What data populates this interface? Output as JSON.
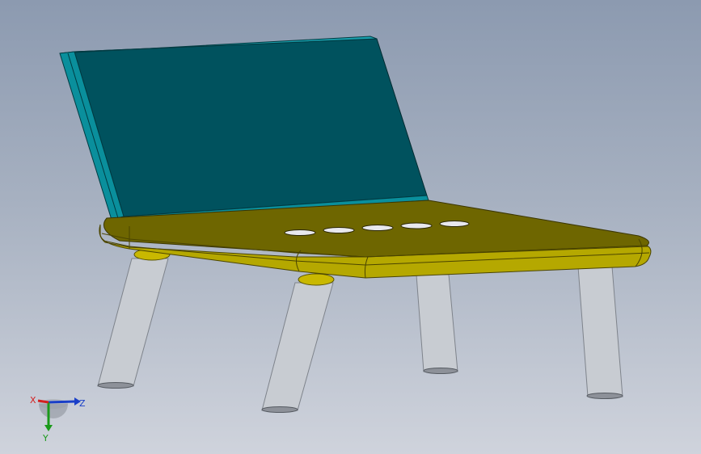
{
  "viewport": {
    "background_top": "#8c9ab0",
    "background_bottom": "#cfd3dc"
  },
  "model": {
    "backrest_color": "#00525e",
    "backrest_edge_color": "#00808f",
    "seat_color": "#6e6600",
    "seat_edge_color": "#b5a800",
    "leg_color": "#c8ccd2"
  },
  "triad": {
    "x_label": "X",
    "y_label": "Y",
    "z_label": "Z",
    "x_color": "#d32020",
    "y_color": "#1a9a1a",
    "z_color": "#1a3fc8"
  }
}
